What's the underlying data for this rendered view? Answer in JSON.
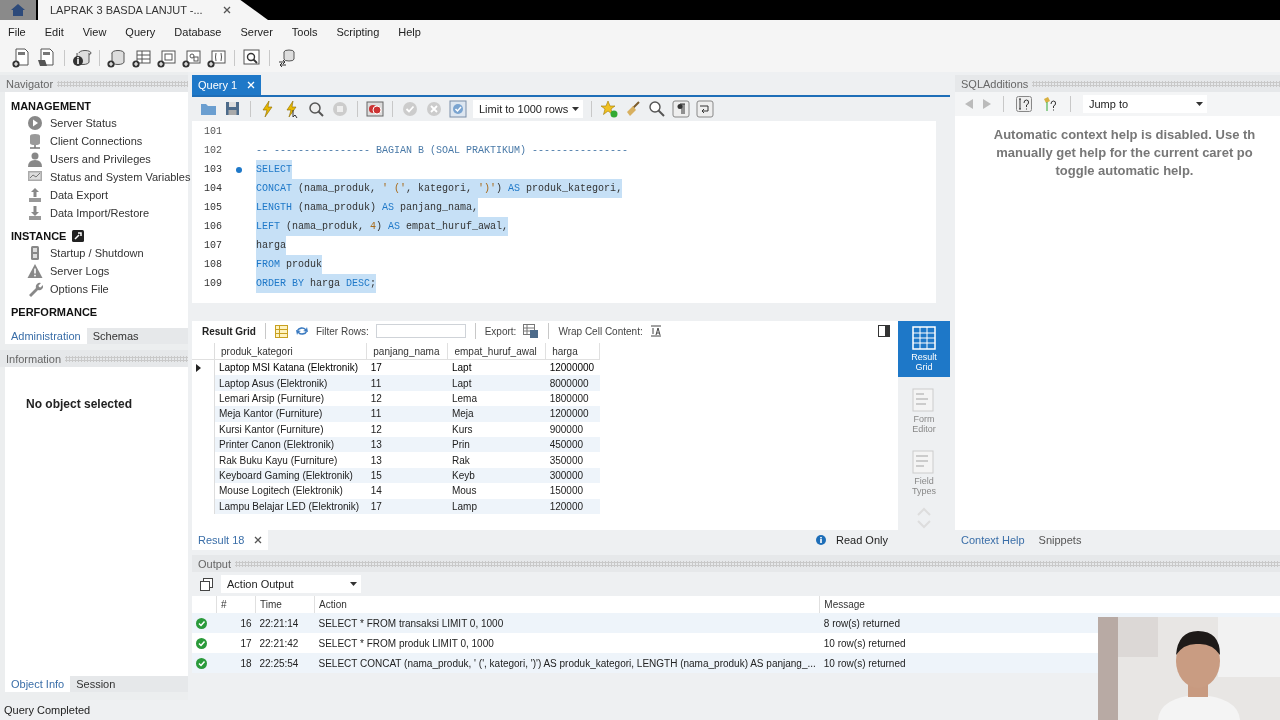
{
  "window_tabs": [
    {
      "kind": "home",
      "selected": false
    },
    {
      "kind": "doc",
      "label": "LAPRAK 3 BASDA LANJUT -...",
      "selected": true
    }
  ],
  "menu": [
    "File",
    "Edit",
    "View",
    "Query",
    "Database",
    "Server",
    "Tools",
    "Scripting",
    "Help"
  ],
  "navigator": {
    "title": "Navigator",
    "sections": [
      {
        "title": "MANAGEMENT",
        "items": [
          "Server Status",
          "Client Connections",
          "Users and Privileges",
          "Status and System Variables",
          "Data Export",
          "Data Import/Restore"
        ]
      },
      {
        "title": "INSTANCE",
        "items": [
          "Startup / Shutdown",
          "Server Logs",
          "Options File"
        ]
      },
      {
        "title": "PERFORMANCE"
      }
    ],
    "tabs": [
      {
        "label": "Administration",
        "selected": true
      },
      {
        "label": "Schemas",
        "selected": false
      }
    ]
  },
  "information": {
    "title": "Information",
    "message": "No object selected",
    "tabs": [
      {
        "label": "Object Info",
        "selected": true
      },
      {
        "label": "Session",
        "selected": false
      }
    ]
  },
  "query_tabs": [
    {
      "label": "Query 1",
      "selected": true
    }
  ],
  "limit_dropdown": "Limit to 1000 rows",
  "editor": {
    "lines": [
      {
        "number": "101",
        "selected": false,
        "marker": false
      },
      {
        "number": "102",
        "selected": false,
        "marker": false,
        "tokens": [
          {
            "kind": "comment",
            "text": "-- ---------------- BAGIAN B (SOAL PRAKTIKUM) ----------------"
          }
        ]
      },
      {
        "number": "103",
        "selected": true,
        "marker": true,
        "tokens": [
          {
            "kind": "keyword",
            "text": "SELECT"
          }
        ]
      },
      {
        "number": "104",
        "selected": true,
        "marker": false,
        "tokens": [
          {
            "kind": "keyword",
            "text": "CONCAT"
          },
          {
            "kind": "plain",
            "text": " (nama_produk, "
          },
          {
            "kind": "string",
            "text": "' ('"
          },
          {
            "kind": "plain",
            "text": ", kategori, "
          },
          {
            "kind": "string",
            "text": "')'"
          },
          {
            "kind": "plain",
            "text": ") "
          },
          {
            "kind": "keyword",
            "text": "AS"
          },
          {
            "kind": "plain",
            "text": " produk_kategori,"
          }
        ]
      },
      {
        "number": "105",
        "selected": true,
        "marker": false,
        "tokens": [
          {
            "kind": "keyword",
            "text": "LENGTH"
          },
          {
            "kind": "plain",
            "text": " (nama_produk) "
          },
          {
            "kind": "keyword",
            "text": "AS"
          },
          {
            "kind": "plain",
            "text": " panjang_nama,"
          }
        ]
      },
      {
        "number": "106",
        "selected": true,
        "marker": false,
        "tokens": [
          {
            "kind": "keyword",
            "text": "LEFT"
          },
          {
            "kind": "plain",
            "text": " (nama_produk, "
          },
          {
            "kind": "number",
            "text": "4"
          },
          {
            "kind": "plain",
            "text": ") "
          },
          {
            "kind": "keyword",
            "text": "AS"
          },
          {
            "kind": "plain",
            "text": " empat_huruf_awal,"
          }
        ]
      },
      {
        "number": "107",
        "selected": true,
        "marker": false,
        "tokens": [
          {
            "kind": "plain",
            "text": "harga"
          }
        ]
      },
      {
        "number": "108",
        "selected": true,
        "marker": false,
        "tokens": [
          {
            "kind": "keyword",
            "text": "FROM"
          },
          {
            "kind": "plain",
            "text": " produk"
          }
        ]
      },
      {
        "number": "109",
        "selected": true,
        "marker": false,
        "tokens": [
          {
            "kind": "keyword",
            "text": "ORDER BY"
          },
          {
            "kind": "plain",
            "text": " harga "
          },
          {
            "kind": "keyword",
            "text": "DESC"
          },
          {
            "kind": "plain",
            "text": ";"
          }
        ]
      }
    ]
  },
  "result_toolbar": {
    "result_grid": "Result Grid",
    "filter_label": "Filter Rows:",
    "export_label": "Export:",
    "wrap_label": "Wrap Cell Content:"
  },
  "result_grid": {
    "columns": [
      "produk_kategori",
      "panjang_nama",
      "empat_huruf_awal",
      "harga"
    ],
    "rows": [
      {
        "selected": true,
        "cells": [
          "Laptop MSI Katana (Elektronik)",
          "17",
          "Lapt",
          "12000000"
        ]
      },
      {
        "selected": false,
        "cells": [
          "Laptop Asus (Elektronik)",
          "11",
          "Lapt",
          "8000000"
        ]
      },
      {
        "selected": false,
        "cells": [
          "Lemari Arsip (Furniture)",
          "12",
          "Lema",
          "1800000"
        ]
      },
      {
        "selected": false,
        "cells": [
          "Meja Kantor (Furniture)",
          "11",
          "Meja",
          "1200000"
        ]
      },
      {
        "selected": false,
        "cells": [
          "Kursi Kantor (Furniture)",
          "12",
          "Kurs",
          "900000"
        ]
      },
      {
        "selected": false,
        "cells": [
          "Printer Canon (Elektronik)",
          "13",
          "Prin",
          "450000"
        ]
      },
      {
        "selected": false,
        "cells": [
          "Rak Buku Kayu (Furniture)",
          "13",
          "Rak",
          "350000"
        ]
      },
      {
        "selected": false,
        "cells": [
          "Keyboard Gaming (Elektronik)",
          "15",
          "Keyb",
          "300000"
        ]
      },
      {
        "selected": false,
        "cells": [
          "Mouse Logitech (Elektronik)",
          "14",
          "Mous",
          "150000"
        ]
      },
      {
        "selected": false,
        "cells": [
          "Lampu Belajar LED (Elektronik)",
          "17",
          "Lamp",
          "120000"
        ]
      }
    ]
  },
  "result_views": [
    {
      "label": "Result Grid",
      "selected": true
    },
    {
      "label": "Form Editor",
      "selected": false
    },
    {
      "label": "Field Types",
      "selected": false
    }
  ],
  "result_tabs": [
    {
      "label": "Result 18",
      "selected": true
    }
  ],
  "read_only": "Read Only",
  "sql_additions": {
    "title": "SQLAdditions",
    "jump_to": "Jump to",
    "help_lines": [
      "Automatic context help is disabled. Use th",
      "manually get help for the current caret po",
      "toggle automatic help."
    ],
    "tabs": [
      {
        "label": "Context Help",
        "selected": true
      },
      {
        "label": "Snippets",
        "selected": false
      }
    ]
  },
  "output": {
    "title": "Output",
    "dropdown": "Action Output",
    "columns": [
      "#",
      "Time",
      "Action",
      "Message"
    ],
    "rows": [
      {
        "number": "16",
        "time": "22:21:14",
        "action": "SELECT * FROM transaksi LIMIT 0, 1000",
        "message": "8 row(s) returned"
      },
      {
        "number": "17",
        "time": "22:21:42",
        "action": "SELECT * FROM produk LIMIT 0, 1000",
        "message": "10 row(s) returned"
      },
      {
        "number": "18",
        "time": "22:25:54",
        "action": "SELECT CONCAT (nama_produk, ' (', kategori, ')') AS produk_kategori, LENGTH (nama_produk) AS panjang_...",
        "message": "10 row(s) returned"
      }
    ]
  },
  "webcam": {
    "kind": "picture"
  },
  "status_bar": "Query Completed"
}
